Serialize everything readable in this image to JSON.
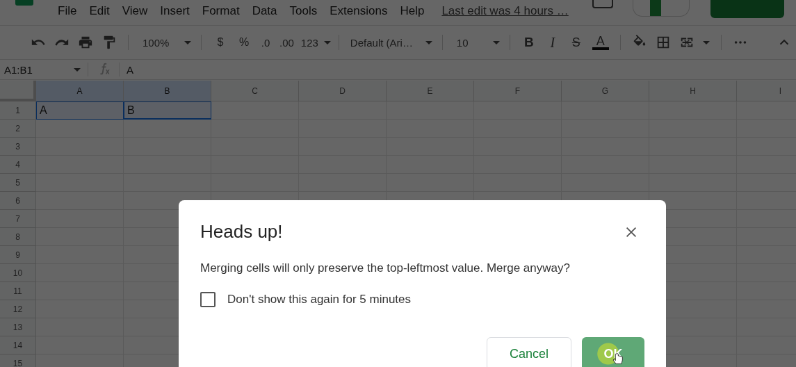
{
  "menu": {
    "items": [
      "File",
      "Edit",
      "View",
      "Insert",
      "Format",
      "Data",
      "Tools",
      "Extensions",
      "Help"
    ],
    "last_edit": "Last edit was 4 hours …"
  },
  "toolbar": {
    "zoom": "100%",
    "currency": "$",
    "percent": "%",
    "decrease_decimals": ".0",
    "increase_decimals": ".00",
    "more_formats": "123",
    "font": "Default (Ari…",
    "font_size": "10",
    "bold": "B",
    "italic": "I",
    "strikethrough": "S",
    "text_color": "A"
  },
  "formula_bar": {
    "name_box": "A1:B1",
    "formula": "A"
  },
  "grid": {
    "columns": [
      {
        "label": "A",
        "selected": true
      },
      {
        "label": "B",
        "selected": true
      },
      {
        "label": "C",
        "selected": false
      },
      {
        "label": "D",
        "selected": false
      },
      {
        "label": "E",
        "selected": false
      },
      {
        "label": "F",
        "selected": false
      },
      {
        "label": "G",
        "selected": false
      },
      {
        "label": "H",
        "selected": false
      },
      {
        "label": "I",
        "selected": false
      }
    ],
    "rows": [
      {
        "number": "1",
        "cells": [
          {
            "text": "A",
            "selected": true
          },
          {
            "text": "B",
            "selected": true
          }
        ]
      },
      {
        "number": "2"
      },
      {
        "number": "3"
      },
      {
        "number": "4"
      },
      {
        "number": "5"
      },
      {
        "number": "6"
      },
      {
        "number": "7"
      },
      {
        "number": "8"
      },
      {
        "number": "9"
      },
      {
        "number": "10"
      },
      {
        "number": "11"
      },
      {
        "number": "12"
      },
      {
        "number": "13"
      },
      {
        "number": "14"
      },
      {
        "number": "15"
      }
    ]
  },
  "dialog": {
    "title": "Heads up!",
    "message": "Merging cells will only preserve the top-leftmost value. Merge anyway?",
    "checkbox": {
      "label": "Don't show this again for 5 minutes",
      "checked": false
    },
    "buttons": [
      {
        "label": "Cancel",
        "kind": "secondary"
      },
      {
        "label": "OK",
        "kind": "primary"
      }
    ]
  }
}
